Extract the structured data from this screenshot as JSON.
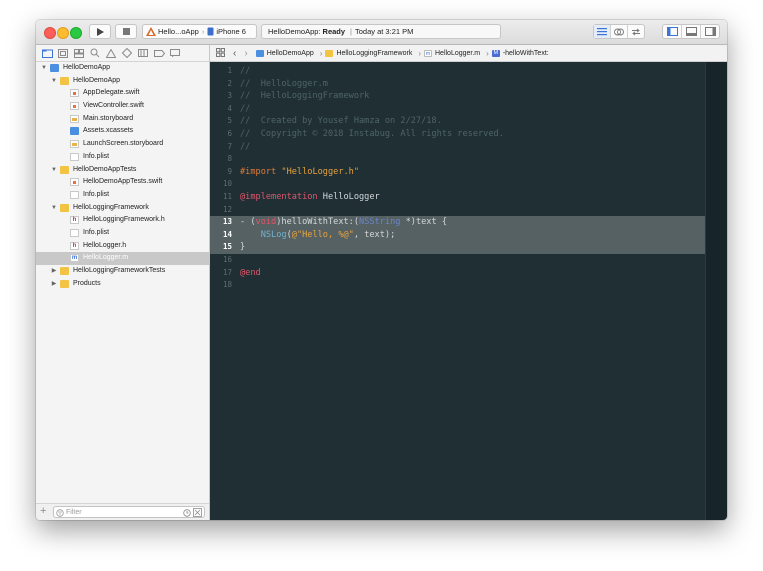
{
  "toolbar": {
    "scheme_name": "Hello...oApp",
    "destination": "iPhone 6",
    "status_app": "HelloDemoApp:",
    "status_state": "Ready",
    "status_time": "Today at 3:21 PM"
  },
  "navigator": {
    "tree": [
      {
        "label": "HelloDemoApp",
        "icon": "project-icon",
        "level": 0,
        "disclosure": "expanded"
      },
      {
        "label": "HelloDemoApp",
        "icon": "folder-icon",
        "level": 1,
        "disclosure": "expanded"
      },
      {
        "label": "AppDelegate.swift",
        "icon": "swift-file-icon",
        "level": 2
      },
      {
        "label": "ViewController.swift",
        "icon": "swift-file-icon",
        "level": 2
      },
      {
        "label": "Main.storyboard",
        "icon": "storyboard-icon",
        "level": 2
      },
      {
        "label": "Assets.xcassets",
        "icon": "assets-icon",
        "level": 2
      },
      {
        "label": "LaunchScreen.storyboard",
        "icon": "storyboard-icon",
        "level": 2
      },
      {
        "label": "Info.plist",
        "icon": "plist-icon",
        "level": 2
      },
      {
        "label": "HelloDemoAppTests",
        "icon": "folder-icon",
        "level": 1,
        "disclosure": "expanded"
      },
      {
        "label": "HelloDemoAppTests.swift",
        "icon": "swift-file-icon",
        "level": 2
      },
      {
        "label": "Info.plist",
        "icon": "plist-icon",
        "level": 2
      },
      {
        "label": "HelloLoggingFramework",
        "icon": "folder-icon",
        "level": 1,
        "disclosure": "expanded"
      },
      {
        "label": "HelloLoggingFramework.h",
        "icon": "header-file-icon",
        "level": 2
      },
      {
        "label": "Info.plist",
        "icon": "plist-icon",
        "level": 2
      },
      {
        "label": "HelloLogger.h",
        "icon": "header-file-icon",
        "level": 2
      },
      {
        "label": "HelloLogger.m",
        "icon": "objc-file-icon",
        "level": 2,
        "selected": true
      },
      {
        "label": "HelloLoggingFrameworkTests",
        "icon": "folder-icon",
        "level": 1,
        "disclosure": "collapsed"
      },
      {
        "label": "Products",
        "icon": "folder-icon",
        "level": 1,
        "disclosure": "collapsed"
      }
    ],
    "filter_placeholder": "Filter"
  },
  "jumpbar": {
    "crumbs": [
      "HelloDemoApp",
      "HelloLoggingFramework",
      "HelloLogger.m",
      "-helloWithText:"
    ],
    "crumb_file_badge": "m",
    "crumb_method_badge": "M"
  },
  "editor": {
    "lines": [
      {
        "n": "1",
        "tokens": [
          {
            "t": "//",
            "c": "comment"
          }
        ]
      },
      {
        "n": "2",
        "tokens": [
          {
            "t": "//  HelloLogger.m",
            "c": "comment"
          }
        ]
      },
      {
        "n": "3",
        "tokens": [
          {
            "t": "//  HelloLoggingFramework",
            "c": "comment"
          }
        ]
      },
      {
        "n": "4",
        "tokens": [
          {
            "t": "//",
            "c": "comment"
          }
        ]
      },
      {
        "n": "5",
        "tokens": [
          {
            "t": "//  Created by Yousef Hamza on 2/27/18.",
            "c": "comment"
          }
        ]
      },
      {
        "n": "6",
        "tokens": [
          {
            "t": "//  Copyright © 2018 Instabug. All rights reserved.",
            "c": "comment"
          }
        ]
      },
      {
        "n": "7",
        "tokens": [
          {
            "t": "//",
            "c": "comment"
          }
        ]
      },
      {
        "n": "8",
        "tokens": []
      },
      {
        "n": "9",
        "tokens": [
          {
            "t": "#import ",
            "c": "pre"
          },
          {
            "t": "\"HelloLogger.h\"",
            "c": "str"
          }
        ]
      },
      {
        "n": "10",
        "tokens": []
      },
      {
        "n": "11",
        "tokens": [
          {
            "t": "@implementation",
            "c": "kw"
          },
          {
            "t": " HelloLogger",
            "c": "plain"
          }
        ]
      },
      {
        "n": "12",
        "tokens": []
      },
      {
        "n": "13",
        "hl": true,
        "tokens": [
          {
            "t": "- (",
            "c": "plain"
          },
          {
            "t": "void",
            "c": "kw"
          },
          {
            "t": ")helloWithText:(",
            "c": "plain"
          },
          {
            "t": "NSString",
            "c": "type"
          },
          {
            "t": " *)text {",
            "c": "plain"
          }
        ]
      },
      {
        "n": "14",
        "hl": true,
        "tokens": [
          {
            "t": "    ",
            "c": "plain"
          },
          {
            "t": "NSLog",
            "c": "func"
          },
          {
            "t": "(",
            "c": "plain"
          },
          {
            "t": "@\"Hello, %@\"",
            "c": "str"
          },
          {
            "t": ", text);",
            "c": "plain"
          }
        ]
      },
      {
        "n": "15",
        "hl": true,
        "tokens": [
          {
            "t": "}",
            "c": "plain"
          }
        ]
      },
      {
        "n": "16",
        "tokens": []
      },
      {
        "n": "17",
        "tokens": [
          {
            "t": "@end",
            "c": "kw"
          }
        ]
      },
      {
        "n": "18",
        "tokens": []
      }
    ]
  },
  "colors": {
    "editor_background": "#1f2f34",
    "current_line_highlight": "#566164",
    "comment": "#4f6468",
    "keyword": "#e0566a",
    "string": "#e8a33d",
    "preprocessor": "#e27b3a",
    "type": "#6a84c8"
  }
}
